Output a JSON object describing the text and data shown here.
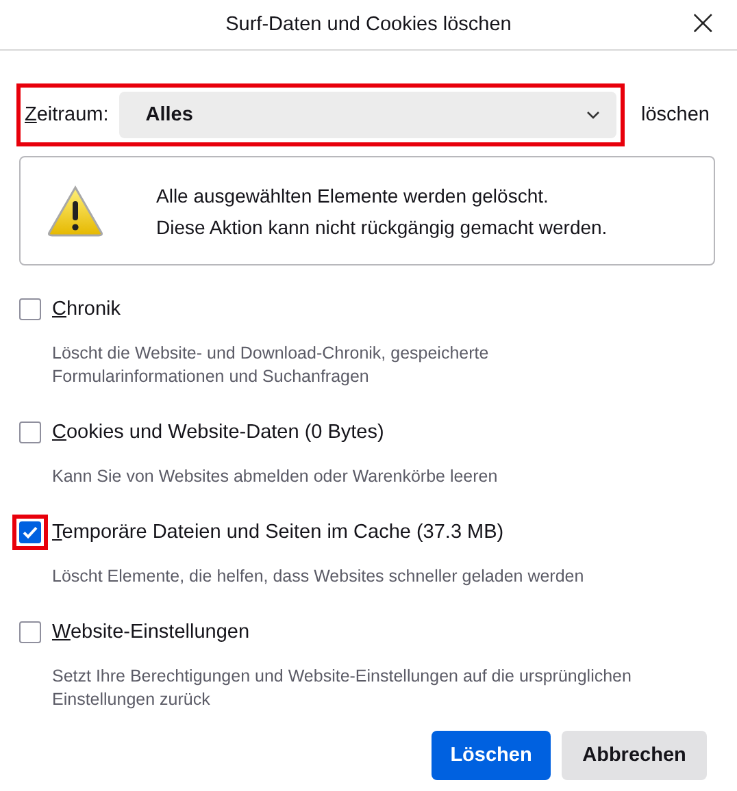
{
  "window": {
    "title": "Surf-Daten und Cookies löschen",
    "close": "×"
  },
  "time_range": {
    "label": "Zeitraum:",
    "value": "Alles",
    "suffix": "löschen",
    "highlighted": true
  },
  "warning": {
    "lines": [
      "Alle ausgewählten Elemente werden gelöscht.",
      "Diese Aktion kann nicht rückgängig gemacht werden."
    ]
  },
  "options": [
    {
      "label": "Chronik",
      "description": "Löscht die Website- und Download-Chronik, gespeicherte Formularinformationen und Suchanfragen",
      "checked": false,
      "highlighted": false
    },
    {
      "label": "Cookies und Website-Daten (0 Bytes)",
      "description": "Kann Sie von Websites abmelden oder Warenkörbe leeren",
      "checked": false,
      "highlighted": false
    },
    {
      "label": "Temporäre Dateien und Seiten im Cache (37.3 MB)",
      "description": "Löscht Elemente, die helfen, dass Websites schneller geladen werden",
      "checked": true,
      "highlighted": true
    },
    {
      "label": "Website-Einstellungen",
      "description": "Setzt Ihre Berechtigungen und Website-Einstellungen auf die ursprünglichen Einstellungen zurück",
      "checked": false,
      "highlighted": false
    }
  ],
  "buttons": [
    {
      "label": "Löschen",
      "kind": "primary"
    },
    {
      "label": "Abbrechen",
      "kind": "secondary"
    }
  ]
}
